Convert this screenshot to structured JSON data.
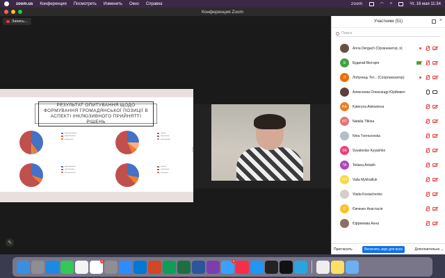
{
  "menubar": {
    "app_name": "zoom.us",
    "menus": [
      "Конференция",
      "Посмотреть",
      "Изменить",
      "Окно",
      "Справка"
    ],
    "zoom_label": "zoom",
    "datetime": "Чт, 16 мая  11:34"
  },
  "window": {
    "title": "Конференция Zoom",
    "record_label": "Запись..."
  },
  "slide": {
    "title": "РЕЗУЛЬТАТ ОПИТУВАННЯ ЩОДО ФОРМУВАННЯ ГРОМАДЯНСЬКОЇ ПОЗИЦІЇ В АСПЕКТІ ІНКЛЮЗИВНОГО ПРИЙНЯТТІ РІШЕНЬ"
  },
  "panel": {
    "title": "Участники (51)",
    "search_placeholder": "Поиск",
    "participants": [
      {
        "initials": "",
        "name": "Anna Dergach (Организатор, я)",
        "color": "#6d4c41",
        "photo": true,
        "recording": true,
        "mic": "muted",
        "cam": "off"
      },
      {
        "initials": "Б",
        "name": "Будигай Вікторія",
        "color": "#43a047",
        "photo": false,
        "recording": false,
        "mic": "muted",
        "cam": "green"
      },
      {
        "initials": "Л",
        "name": "Лобунець Тет... (Соорганизатор)",
        "color": "#ef6c00",
        "photo": false,
        "recording": true,
        "mic": "muted",
        "cam": "off"
      },
      {
        "initials": "",
        "name": "Алексеева Олександр Юрійович",
        "color": "#5d4037",
        "photo": true,
        "recording": false,
        "mic": "on",
        "cam": "on"
      },
      {
        "initials": "KA",
        "name": "Kateryna Alekseieva",
        "color": "#e67e22",
        "photo": false,
        "recording": false,
        "mic": "muted",
        "cam": "off"
      },
      {
        "initials": "NT",
        "name": "Natalia Tilkina",
        "color": "#e57373",
        "photo": false,
        "recording": false,
        "mic": "muted",
        "cam": "off"
      },
      {
        "initials": "",
        "name": "Nina Tverezovska",
        "color": "#b0bec5",
        "photo": true,
        "recording": false,
        "mic": "muted",
        "cam": "off"
      },
      {
        "initials": "SK",
        "name": "Svyatoslav Kyyashko",
        "color": "#ec407a",
        "photo": false,
        "recording": false,
        "mic": "muted",
        "cam": "off"
      },
      {
        "initials": "TA",
        "name": "Tetiana Artiukh",
        "color": "#ab47bc",
        "photo": false,
        "recording": false,
        "mic": "muted",
        "cam": "off"
      },
      {
        "initials": "VM",
        "name": "Valia Mykhailiuk",
        "color": "#fdd835",
        "photo": false,
        "recording": false,
        "mic": "muted",
        "cam": "off"
      },
      {
        "initials": "",
        "name": "Vlada Kosiachenko",
        "color": "#d7ccc8",
        "photo": true,
        "recording": false,
        "mic": "muted",
        "cam": "off"
      },
      {
        "initials": "Є",
        "name": "Євченко Анастасія",
        "color": "#fbc02d",
        "photo": false,
        "recording": false,
        "mic": "muted",
        "cam": "off"
      },
      {
        "initials": "",
        "name": "Єфремова Анна",
        "color": "#8d6e63",
        "photo": true,
        "recording": false,
        "mic": "muted",
        "cam": "off"
      }
    ],
    "invite_label": "Пригласить",
    "unmute_all_label": "Включить звук для всех",
    "more_label": "Дополнительно"
  },
  "dock": {
    "apps": [
      {
        "name": "finder",
        "color": "#3b8fe0"
      },
      {
        "name": "launchpad",
        "color": "#8e8e93"
      },
      {
        "name": "safari",
        "color": "#1e88e5"
      },
      {
        "name": "facetime",
        "color": "#34c759"
      },
      {
        "name": "photos",
        "color": "#f4f4f4"
      },
      {
        "name": "calendar",
        "color": "#ffffff"
      },
      {
        "name": "settings",
        "color": "#8e8e93"
      },
      {
        "name": "zoom",
        "color": "#2d8cff"
      },
      {
        "name": "outlook",
        "color": "#0078d4"
      },
      {
        "name": "powerpoint",
        "color": "#d24726"
      },
      {
        "name": "edge",
        "color": "#0f9d58"
      },
      {
        "name": "excel",
        "color": "#1d6f42"
      },
      {
        "name": "word",
        "color": "#2b579a"
      },
      {
        "name": "viber",
        "color": "#7d3daf"
      },
      {
        "name": "mail",
        "color": "#3ba1ff"
      },
      {
        "name": "music",
        "color": "#fa2d48"
      },
      {
        "name": "appstore",
        "color": "#2196f3"
      },
      {
        "name": "activity",
        "color": "#222"
      },
      {
        "name": "terminal",
        "color": "#111"
      },
      {
        "name": "telegram",
        "color": "#2aa3e0"
      },
      {
        "name": "preview",
        "color": "#eeeeee"
      },
      {
        "name": "notes",
        "color": "#ffe066"
      },
      {
        "name": "downloads",
        "color": "#6ab0f3"
      }
    ],
    "badges": {
      "calendar": "1",
      "mail": "1"
    }
  }
}
